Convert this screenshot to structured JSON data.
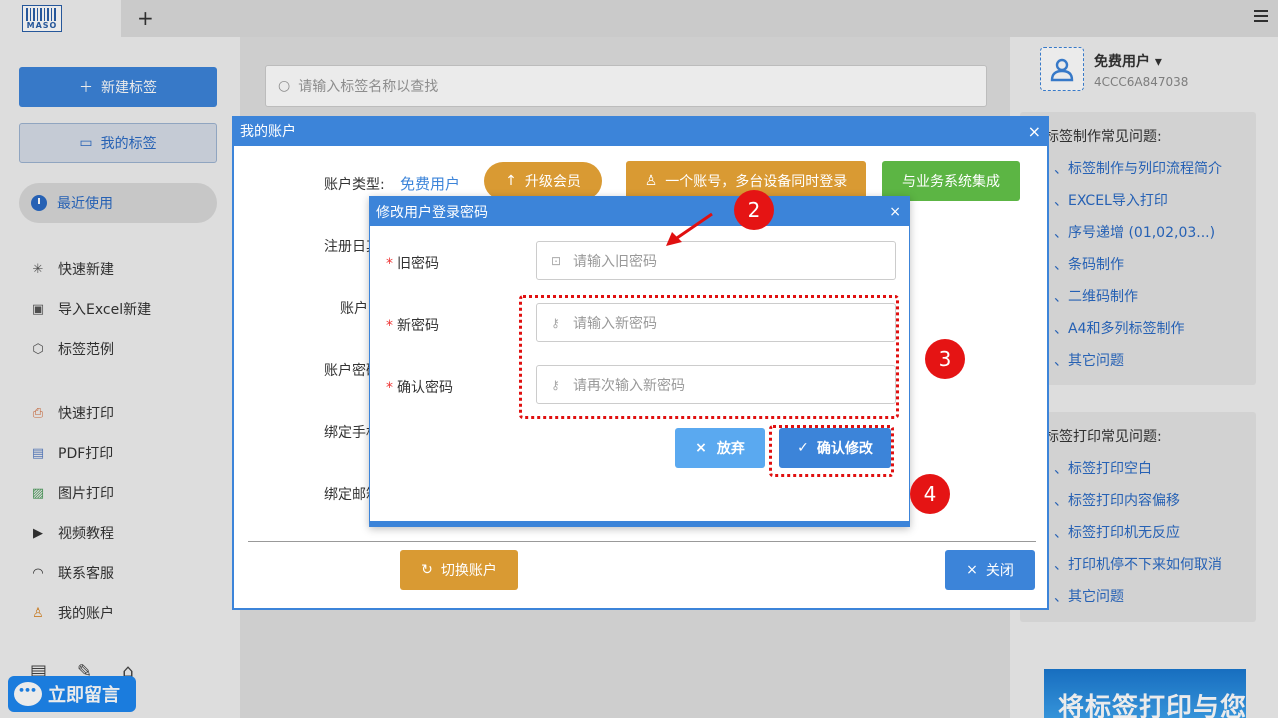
{
  "app": {
    "logo_text": "MASO",
    "new_tab_symbol": "+"
  },
  "sidebar": {
    "new_label": "新建标签",
    "my_labels": "我的标签",
    "recent": "最近使用",
    "items": [
      {
        "label": "快速新建",
        "icon": "sparkle-icon"
      },
      {
        "label": "导入Excel新建",
        "icon": "excel-icon"
      },
      {
        "label": "标签范例",
        "icon": "cube-icon"
      },
      {
        "label": "快速打印",
        "icon": "printer-icon"
      },
      {
        "label": "PDF打印",
        "icon": "pdf-icon"
      },
      {
        "label": "图片打印",
        "icon": "image-icon"
      },
      {
        "label": "视频教程",
        "icon": "video-icon"
      },
      {
        "label": "联系客服",
        "icon": "headset-icon"
      },
      {
        "label": "我的账户",
        "icon": "user-icon"
      }
    ],
    "chat_label": "立即留言"
  },
  "search": {
    "placeholder": "请输入标签名称以查找"
  },
  "user": {
    "name": "免费用户",
    "id": "4CCC6A847038"
  },
  "faq_make": {
    "title": "标签制作常见问题:",
    "items": [
      "、标签制作与列印流程简介",
      "、EXCEL导入打印",
      "、序号递增 (01,02,03...)",
      "、条码制作",
      "、二维码制作",
      "、A4和多列标签制作",
      "、其它问题"
    ]
  },
  "faq_print": {
    "title": "标签打印常见问题:",
    "items": [
      "、标签打印空白",
      "、标签打印内容偏移",
      "、标签打印机无反应",
      "、打印机停不下来如何取消",
      "、其它问题"
    ]
  },
  "banner_text": "将标签打印与您",
  "account_dialog": {
    "title": "我的账户",
    "type_label": "账户类型:",
    "type_value": "免费用户",
    "upgrade": "升级会员",
    "multi_device": "一个账号，多台设备同时登录",
    "integrate": "与业务系统集成",
    "reg_label": "注册日其",
    "acct_label": "账户I",
    "pwd_label": "账户密码",
    "phone_label": "绑定手机",
    "email_label": "绑定邮箱",
    "switch": "切换账户",
    "close": "关闭"
  },
  "password_dialog": {
    "title": "修改用户登录密码",
    "required_mark": "*",
    "old_label": "旧密码",
    "old_placeholder": "请输入旧密码",
    "new_label": "新密码",
    "new_placeholder": "请输入新密码",
    "confirm_label": "确认密码",
    "confirm_placeholder": "请再次输入新密码",
    "cancel": "放弃",
    "confirm": "确认修改"
  },
  "annotations": [
    "2",
    "3",
    "4"
  ],
  "colors": {
    "primary": "#3c84d9",
    "orange": "#d99a33",
    "green": "#5cb544",
    "annotation_red": "#e51414"
  }
}
